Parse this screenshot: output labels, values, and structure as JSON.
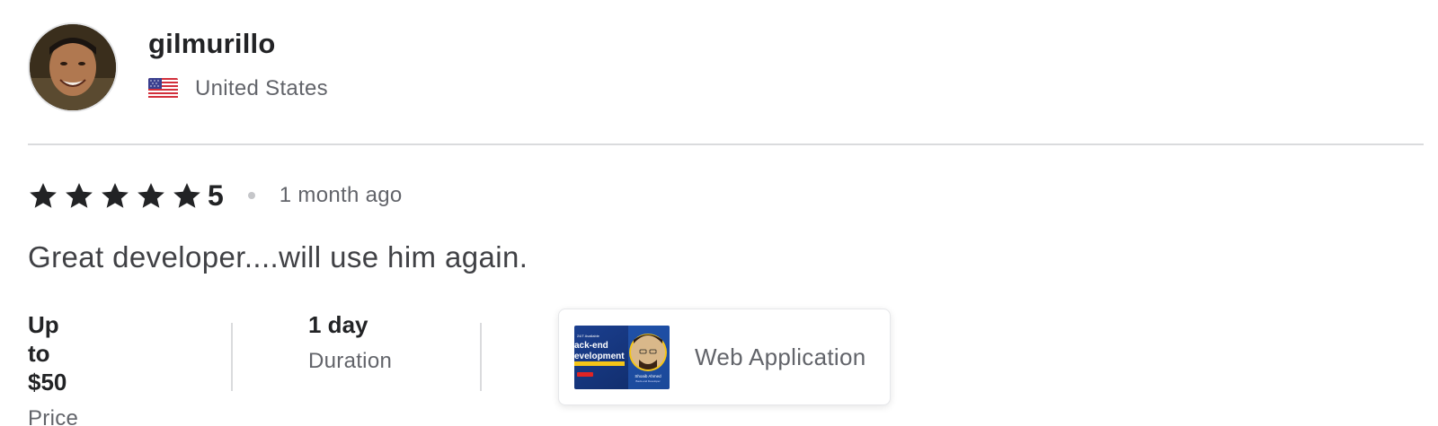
{
  "reviewer": {
    "username": "gilmurillo",
    "country": "United States",
    "avatar_icon": "user-avatar-photo",
    "flag_icon": "us-flag-icon"
  },
  "rating": {
    "stars": 5,
    "value": "5",
    "time_ago": "1 month ago",
    "star_color": "#222325"
  },
  "review_text": "Great developer....will use him again.",
  "details": {
    "price": {
      "value": "Up to $50",
      "label": "Price"
    },
    "duration": {
      "value": "1 day",
      "label": "Duration"
    }
  },
  "gig": {
    "title": "Web Application",
    "thumbnail": {
      "line1": "ack-end",
      "line2": "evelopment",
      "badge": "24/7 Available",
      "name": "Shoaib Ahmed",
      "subtitle": "Back-end Developer",
      "bg_color": "#1b3f8f",
      "accent_color": "#f5c518"
    }
  }
}
